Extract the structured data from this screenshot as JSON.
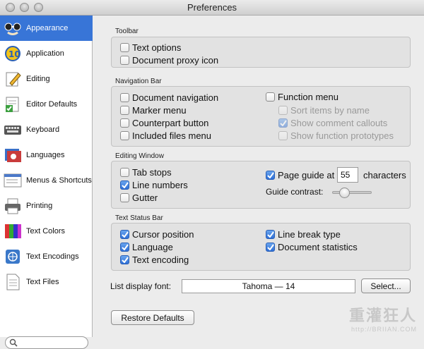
{
  "window": {
    "title": "Preferences"
  },
  "sidebar": {
    "items": [
      {
        "label": "Appearance",
        "icon": "mask-icon",
        "selected": true
      },
      {
        "label": "Application",
        "icon": "app-icon"
      },
      {
        "label": "Editing",
        "icon": "pencil-icon"
      },
      {
        "label": "Editor Defaults",
        "icon": "document-check-icon"
      },
      {
        "label": "Keyboard",
        "icon": "keyboard-icon"
      },
      {
        "label": "Languages",
        "icon": "languages-icon"
      },
      {
        "label": "Menus & Shortcuts",
        "icon": "menus-icon"
      },
      {
        "label": "Printing",
        "icon": "printer-icon"
      },
      {
        "label": "Text Colors",
        "icon": "colors-icon"
      },
      {
        "label": "Text Encodings",
        "icon": "globe-icon"
      },
      {
        "label": "Text Files",
        "icon": "text-file-icon"
      }
    ],
    "search_placeholder": ""
  },
  "toolbar": {
    "title": "Toolbar",
    "text_options": {
      "label": "Text options",
      "checked": false
    },
    "document_proxy_icon": {
      "label": "Document proxy icon",
      "checked": false
    }
  },
  "navigation_bar": {
    "title": "Navigation Bar",
    "document_navigation": {
      "label": "Document navigation",
      "checked": false
    },
    "marker_menu": {
      "label": "Marker menu",
      "checked": false
    },
    "counterpart_button": {
      "label": "Counterpart button",
      "checked": false
    },
    "included_files_menu": {
      "label": "Included files menu",
      "checked": false
    },
    "function_menu": {
      "label": "Function menu",
      "checked": false
    },
    "sort_items_by_name": {
      "label": "Sort items by name",
      "checked": false,
      "disabled": true
    },
    "show_comment_callouts": {
      "label": "Show comment callouts",
      "checked": true,
      "disabled": true
    },
    "show_function_prototypes": {
      "label": "Show function prototypes",
      "checked": false,
      "disabled": true
    }
  },
  "editing_window": {
    "title": "Editing Window",
    "tab_stops": {
      "label": "Tab stops",
      "checked": false
    },
    "line_numbers": {
      "label": "Line numbers",
      "checked": true
    },
    "gutter": {
      "label": "Gutter",
      "checked": false
    },
    "page_guide": {
      "label": "Page guide at",
      "checked": true,
      "value": "55",
      "suffix": "characters"
    },
    "guide_contrast": {
      "label": "Guide contrast:",
      "value": 0.3
    }
  },
  "text_status_bar": {
    "title": "Text Status Bar",
    "cursor_position": {
      "label": "Cursor position",
      "checked": true
    },
    "language": {
      "label": "Language",
      "checked": true
    },
    "text_encoding": {
      "label": "Text encoding",
      "checked": true
    },
    "line_break_type": {
      "label": "Line break type",
      "checked": true
    },
    "document_statistics": {
      "label": "Document statistics",
      "checked": true
    }
  },
  "font": {
    "label": "List display font:",
    "value": "Tahoma — 14",
    "select_button": "Select..."
  },
  "restore_defaults_button": "Restore Defaults",
  "watermark": {
    "line1": "重灌狂人",
    "line2": "http://BRIIAN.COM"
  },
  "colors": {
    "accent": "#3875d7"
  }
}
